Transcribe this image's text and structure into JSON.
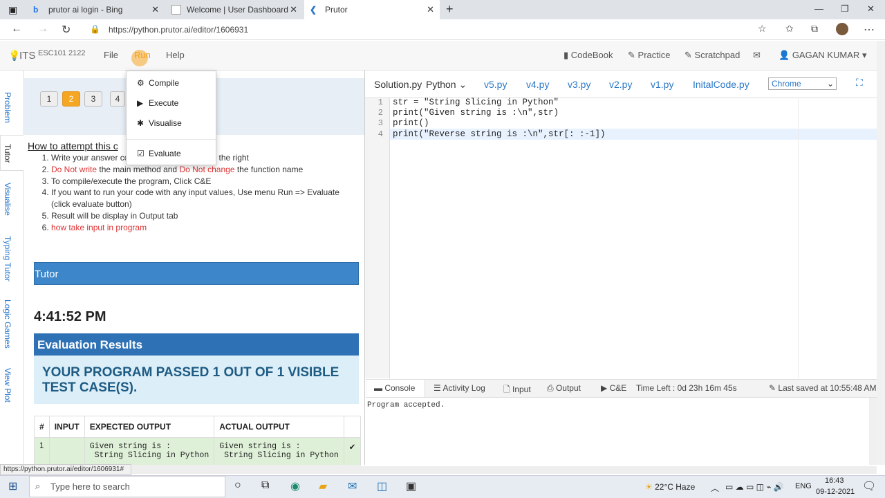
{
  "browser": {
    "tabs": [
      {
        "title": "prutor ai login - Bing"
      },
      {
        "title": "Welcome | User Dashboard | Pru"
      },
      {
        "title": "Prutor"
      }
    ],
    "new_tab": "+",
    "url": "https://python.prutor.ai/editor/1606931",
    "window_controls": [
      "—",
      "❐",
      "✕"
    ]
  },
  "header": {
    "brand": "ITS",
    "course": "ESC101 2122",
    "menu": [
      "File",
      "Run",
      "Help"
    ],
    "links": [
      "CodeBook",
      "Practice",
      "Scratchpad"
    ],
    "user": "GAGAN KUMAR"
  },
  "run_menu": {
    "items": [
      "Compile",
      "Execute",
      "Visualise",
      "Evaluate"
    ]
  },
  "side_nav": [
    "Problem",
    "Tutor",
    "Visualise",
    "Typing Tutor",
    "Logic Games",
    "View Plot"
  ],
  "problem": {
    "numbers": [
      "1",
      "2",
      "3",
      "4"
    ],
    "selected": "2",
    "howto_title": "How to attempt this c",
    "steps": [
      {
        "parts": [
          {
            "t": "Write your answer co",
            "red": false
          },
          {
            "t": "                                  on the right",
            "red": false
          }
        ]
      },
      {
        "parts": [
          {
            "t": "Do Not write",
            "red": true
          },
          {
            "t": " the main method and ",
            "red": false
          },
          {
            "t": "Do Not change",
            "red": true
          },
          {
            "t": " the function name",
            "red": false
          }
        ]
      },
      {
        "parts": [
          {
            "t": "To compile/execute the program, Click C&E",
            "red": false
          }
        ]
      },
      {
        "parts": [
          {
            "t": "If you want to run your code with any input values, Use menu Run => Evaluate (click evaluate button)",
            "red": false
          }
        ]
      },
      {
        "parts": [
          {
            "t": "Result will be display in Output tab",
            "red": false
          }
        ]
      },
      {
        "parts": [
          {
            "t": "how take input in program",
            "red": true
          }
        ]
      }
    ],
    "tutor_title": "Tutor",
    "clock": "4:41:52 PM",
    "eval_title": "Evaluation Results",
    "eval_message": "YOUR PROGRAM PASSED 1 OUT OF 1 VISIBLE TEST CASE(S).",
    "table": {
      "headers": [
        "#",
        "INPUT",
        "EXPECTED OUTPUT",
        "ACTUAL OUTPUT",
        ""
      ],
      "rows": [
        {
          "num": "1",
          "input": "",
          "expected": "Given string is :\n String Slicing in Python",
          "actual": "Given string is :\n String Slicing in Python",
          "check": "✔"
        }
      ]
    }
  },
  "editor": {
    "file": "Solution.py",
    "language": "Python",
    "versions": [
      "v5.py",
      "v4.py",
      "v3.py",
      "v2.py",
      "v1.py",
      "InitalCode.py"
    ],
    "browser_select": "Chrome",
    "lines": [
      "str = \"String Slicing in Python\"",
      "print(\"Given string is :\\n\",str)",
      "print()",
      "print(\"Reverse string is :\\n\",str[: :-1])"
    ],
    "line_numbers": [
      "1",
      "2",
      "3",
      "4"
    ]
  },
  "console": {
    "tabs": [
      "Console",
      "Activity Log",
      "Input",
      "Output",
      "C&E"
    ],
    "time_left": "Time Left : 0d 23h 16m 45s",
    "last_saved": "Last saved at 10:55:48 AM",
    "output": "Program accepted."
  },
  "status_url": "https://python.prutor.ai/editor/1606931#",
  "taskbar": {
    "search_placeholder": "Type here to search",
    "weather": "22°C  Haze",
    "lang": "ENG",
    "time": "16:43",
    "date": "09-12-2021"
  }
}
